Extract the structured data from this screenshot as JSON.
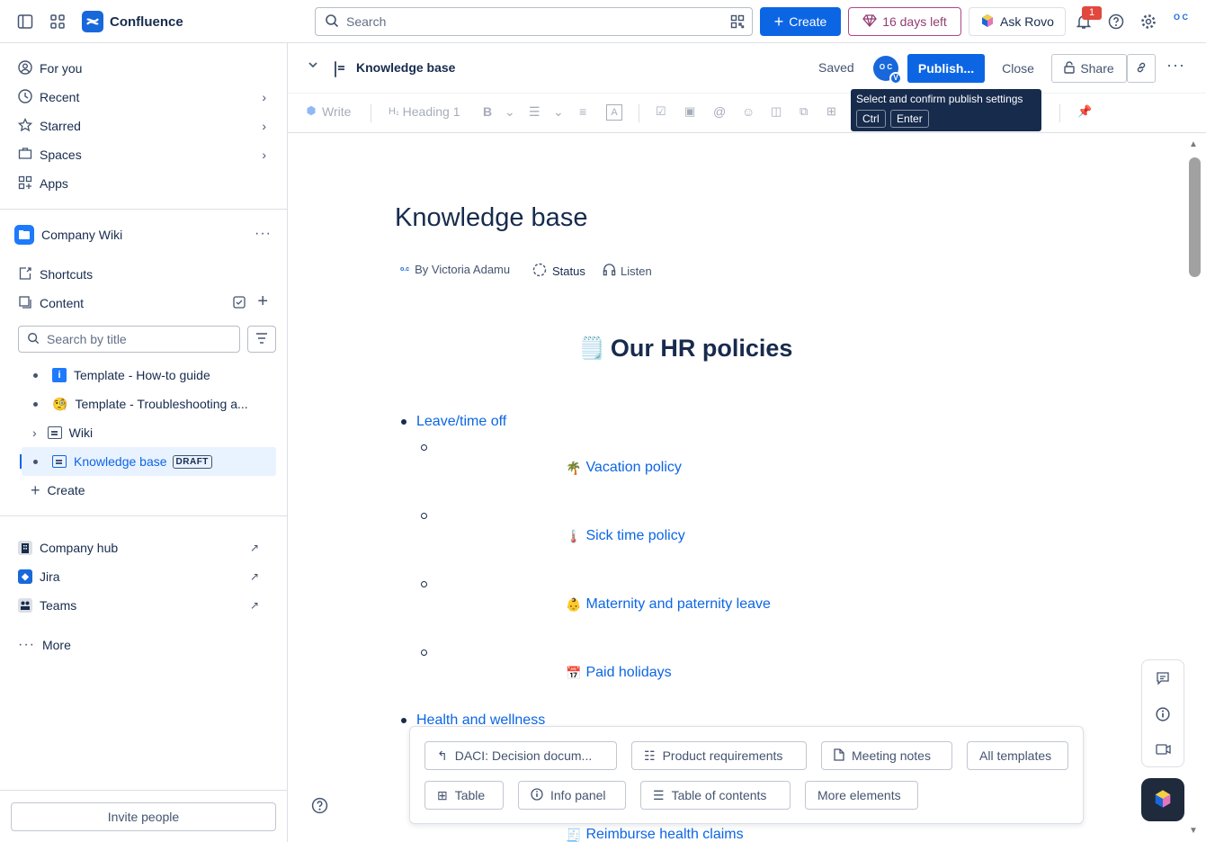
{
  "topbar": {
    "app_name": "Confluence",
    "search_placeholder": "Search",
    "create_label": "Create",
    "trial_label": "16 days left",
    "rovo_label": "Ask Rovo",
    "notif_count": "1",
    "avatar_initials": "O C"
  },
  "sidebar": {
    "nav": [
      {
        "label": "For you"
      },
      {
        "label": "Recent"
      },
      {
        "label": "Starred"
      },
      {
        "label": "Spaces"
      },
      {
        "label": "Apps"
      }
    ],
    "space_name": "Company Wiki",
    "shortcuts_label": "Shortcuts",
    "content_label": "Content",
    "search_placeholder": "Search by title",
    "tree": [
      {
        "label": "Template - How-to guide"
      },
      {
        "label": "Template - Troubleshooting a..."
      },
      {
        "label": "Wiki"
      },
      {
        "label": "Knowledge base",
        "badge": "DRAFT"
      }
    ],
    "create_label": "Create",
    "apps": [
      {
        "label": "Company hub"
      },
      {
        "label": "Jira"
      },
      {
        "label": "Teams"
      }
    ],
    "more_label": "More",
    "invite_label": "Invite people"
  },
  "editor": {
    "breadcrumb_title": "Knowledge base",
    "saved_label": "Saved",
    "avatar_initials": "O C",
    "avatar_badge": "V",
    "publish_label": "Publish...",
    "close_label": "Close",
    "share_label": "Share",
    "toolbar": {
      "write": "Write",
      "heading": "Heading 1"
    },
    "tooltip": {
      "text": "Select and confirm publish settings",
      "key1": "Ctrl",
      "key2": "Enter"
    }
  },
  "page": {
    "title": "Knowledge base",
    "byline": "By Victoria Adamu",
    "status_label": "Status",
    "listen_label": "Listen",
    "heading_emoji": "🗒️",
    "heading": "Our HR policies",
    "section1": "Leave/time off",
    "items": [
      {
        "emoji": "🌴",
        "label": "Vacation policy"
      },
      {
        "emoji": "🌡️",
        "label": "Sick time policy"
      },
      {
        "emoji": "👶",
        "label": "Maternity and paternity leave"
      },
      {
        "emoji": "📅",
        "label": "Paid holidays"
      }
    ],
    "section2": "Health and wellness",
    "partial_item": {
      "emoji": "🧾",
      "label": "Reimburse health claims"
    }
  },
  "templates": {
    "row1": [
      "DACI: Decision docum...",
      "Product requirements",
      "Meeting notes",
      "All templates"
    ],
    "row2": [
      "Table",
      "Info panel",
      "Table of contents",
      "More elements"
    ]
  },
  "colors": {
    "accent": "#0c66e4",
    "trial": "#943d73",
    "tooltip": "#172b4d"
  }
}
